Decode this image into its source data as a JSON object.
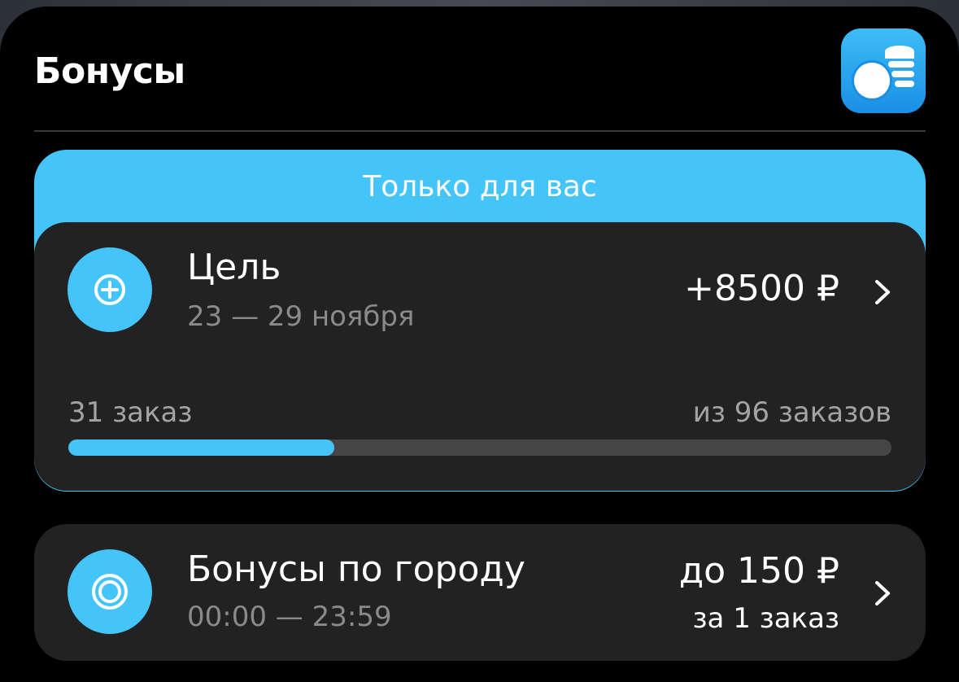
{
  "header": {
    "title": "Бонусы",
    "app_icon": "coins-stack-icon"
  },
  "promo": {
    "label": "Только для вас"
  },
  "goal_card": {
    "icon": "plus-circle-icon",
    "title": "Цель",
    "dates": "23 — 29 ноября",
    "amount": "+8500 ₽",
    "progress_done_label": "31 заказ",
    "progress_total_label": "из 96 заказов",
    "progress_done": 31,
    "progress_total": 96
  },
  "city_card": {
    "icon": "target-circle-icon",
    "title": "Бонусы по городу",
    "time": "00:00 — 23:59",
    "amount": "до 150 ₽",
    "amount_sub": "за 1 заказ"
  },
  "colors": {
    "accent": "#45c4f9",
    "card_bg": "#222222",
    "background": "#000000"
  }
}
